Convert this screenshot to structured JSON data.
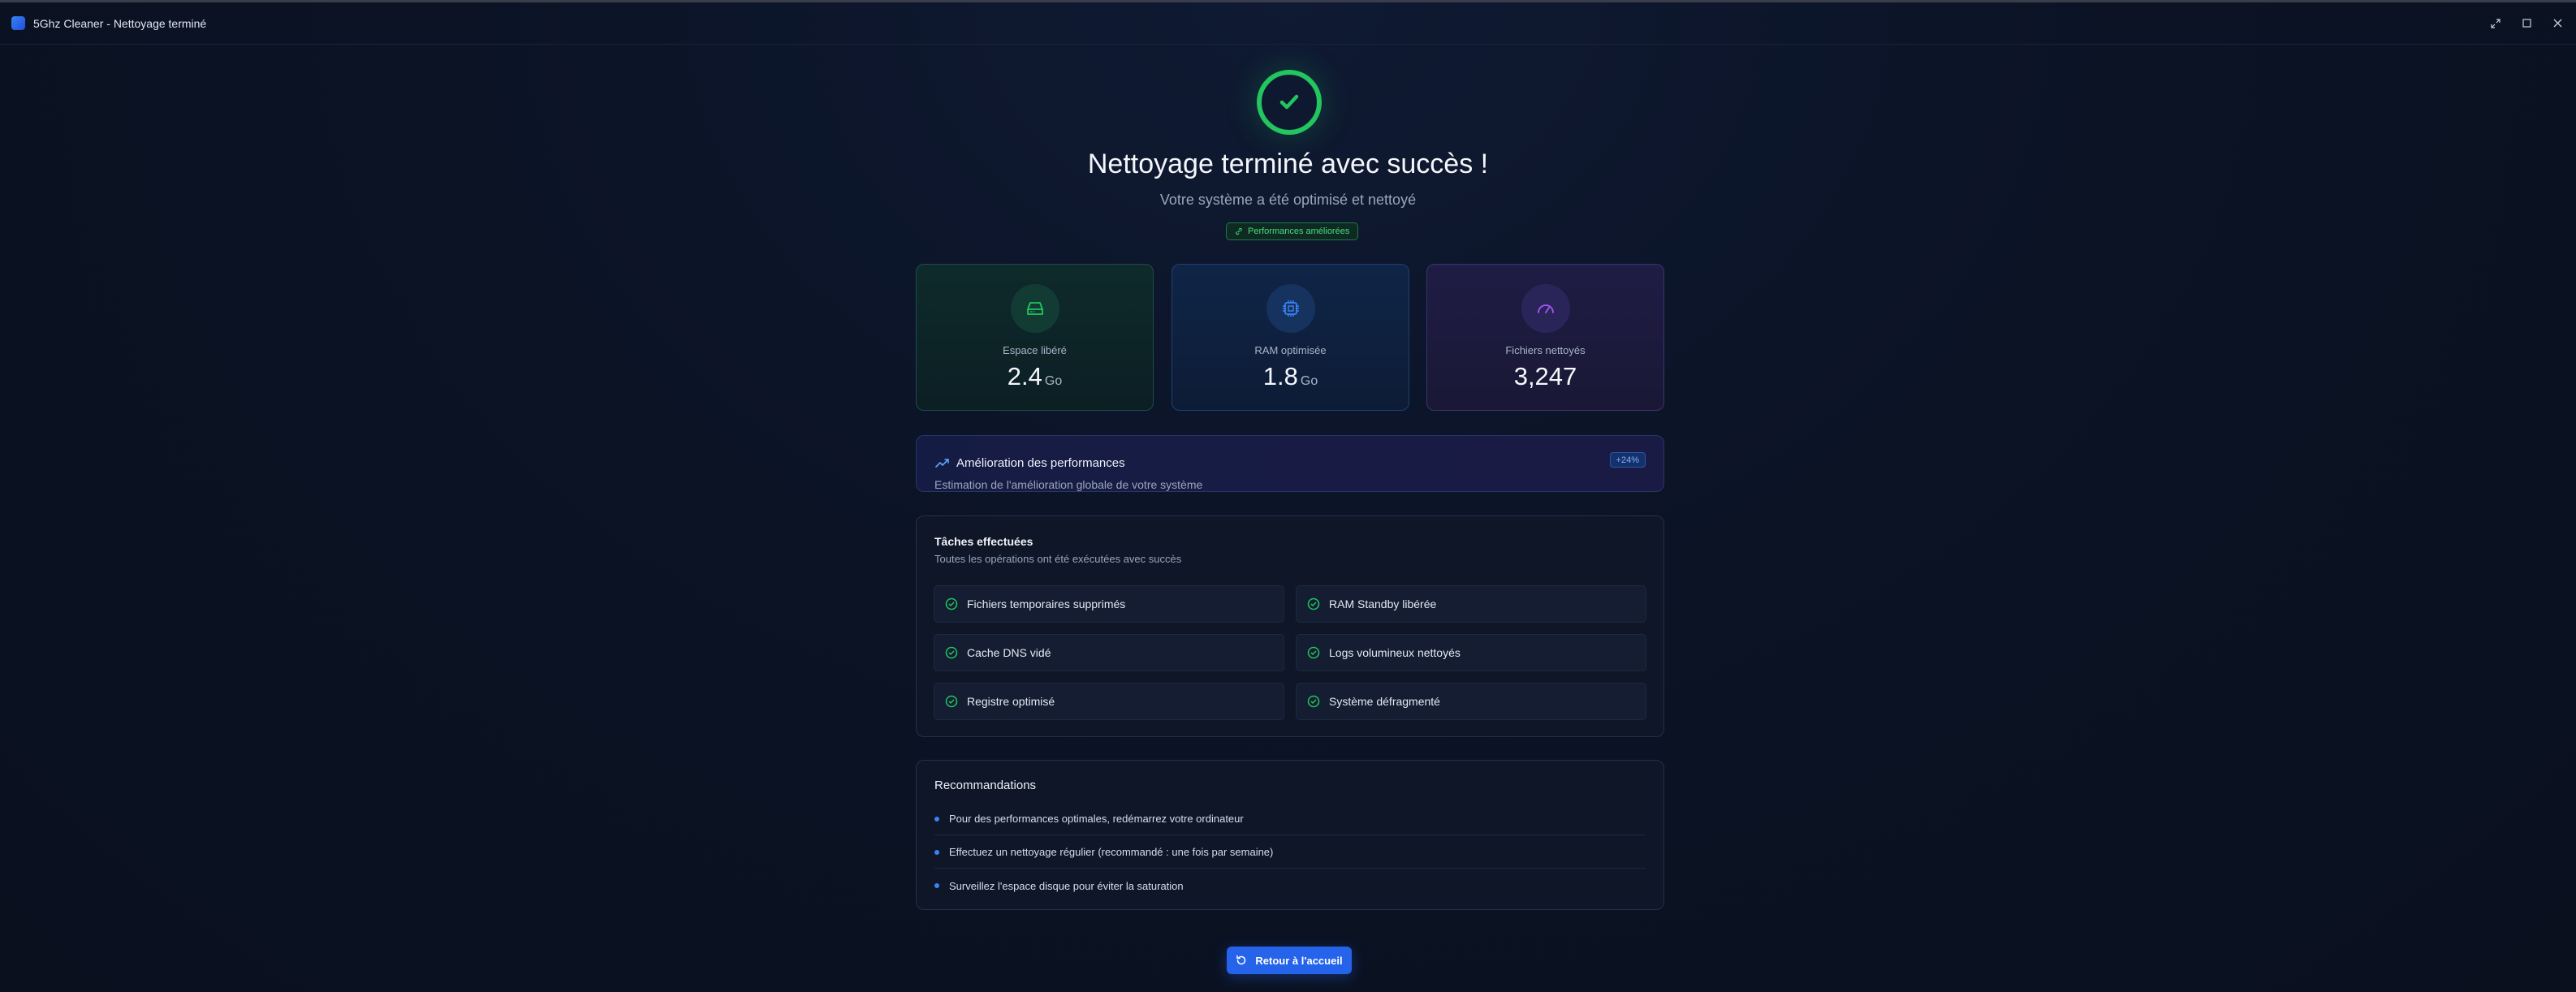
{
  "window": {
    "title": "5Ghz Cleaner - Nettoyage terminé"
  },
  "hero": {
    "title": "Nettoyage terminé avec succès !",
    "subtitle": "Votre système a été optimisé et nettoyé",
    "badge": "Performances améliorées"
  },
  "stats": [
    {
      "label": "Espace libéré",
      "value": "2.4",
      "unit": "Go",
      "icon": "hard-drive-icon",
      "accent": "#22c55e"
    },
    {
      "label": "RAM optimisée",
      "value": "1.8",
      "unit": "Go",
      "icon": "cpu-chip-icon",
      "accent": "#3b82f6"
    },
    {
      "label": "Fichiers nettoyés",
      "value": "3,247",
      "unit": "",
      "icon": "gauge-icon",
      "accent": "#a855f7"
    }
  ],
  "performance": {
    "title": "Amélioration des performances",
    "subtitle": "Estimation de l'amélioration globale de votre système",
    "badge": "+24%",
    "icon": "trending-up-icon"
  },
  "tasks": {
    "title": "Tâches effectuées",
    "subtitle": "Toutes les opérations ont été exécutées avec succès",
    "items": [
      "Fichiers temporaires supprimés",
      "RAM Standby libérée",
      "Cache DNS vidé",
      "Logs volumineux nettoyés",
      "Registre optimisé",
      "Système défragmenté"
    ]
  },
  "recommendations": {
    "title": "Recommandations",
    "items": [
      "Pour des performances optimales, redémarrez votre ordinateur",
      "Effectuez un nettoyage régulier (recommandé : une fois par semaine)",
      "Surveillez l'espace disque pour éviter la saturation"
    ]
  },
  "actions": {
    "home_label": "Retour à l'accueil"
  },
  "colors": {
    "success": "#22c55e",
    "primary": "#2563eb",
    "background": "#0b1222"
  }
}
